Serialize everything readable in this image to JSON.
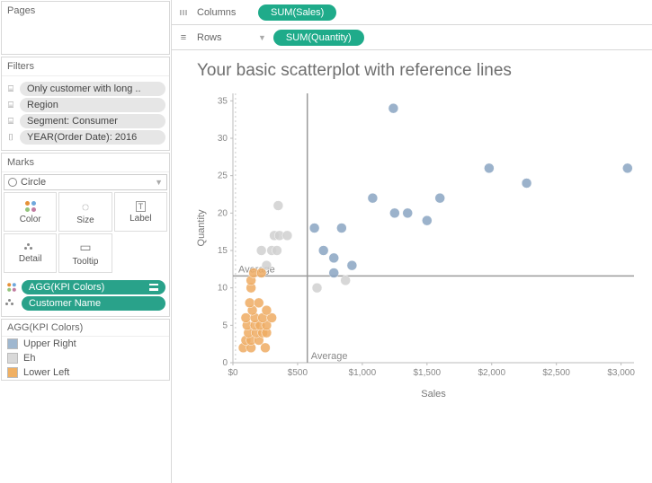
{
  "pages": {
    "label": "Pages"
  },
  "filters": {
    "label": "Filters",
    "items": [
      "Only customer with long ..",
      "Region",
      "Segment: Consumer",
      "YEAR(Order Date): 2016"
    ]
  },
  "marks": {
    "label": "Marks",
    "type": "Circle",
    "cells": [
      "Color",
      "Size",
      "Label",
      "Detail",
      "Tooltip"
    ],
    "pills": [
      "AGG(KPI Colors)",
      "Customer Name"
    ]
  },
  "legend": {
    "title": "AGG(KPI Colors)",
    "items": [
      {
        "label": "Upper Right",
        "color": "#9fb7cf"
      },
      {
        "label": "Eh",
        "color": "#d9d9d9"
      },
      {
        "label": "Lower Left",
        "color": "#f0b063"
      }
    ]
  },
  "shelves": {
    "columns": {
      "label": "Columns",
      "icon": "⦀",
      "pill": "SUM(Sales)"
    },
    "rows": {
      "label": "Rows",
      "icon": "≣",
      "pill": "SUM(Quantity)"
    }
  },
  "chart": {
    "title": "Your basic scatterplot with reference lines",
    "xlabel": "Sales",
    "ylabel": "Quantity",
    "avg_label": "Average"
  },
  "chart_data": {
    "type": "scatter",
    "xlabel": "Sales",
    "ylabel": "Quantity",
    "xlim": [
      0,
      3100
    ],
    "ylim": [
      0,
      36
    ],
    "x_ticks": [
      0,
      500,
      1000,
      1500,
      2000,
      2500,
      3000
    ],
    "x_tick_labels": [
      "$0",
      "$500",
      "$1,000",
      "$1,500",
      "$2,000",
      "$2,500",
      "$3,000"
    ],
    "y_ticks": [
      0,
      5,
      10,
      15,
      20,
      25,
      30,
      35
    ],
    "reference_lines": {
      "x": 575,
      "y": 11.6,
      "label": "Average"
    },
    "series": [
      {
        "name": "Upper Right",
        "color": "#8aa4c2",
        "points": [
          [
            630,
            18
          ],
          [
            840,
            18
          ],
          [
            1240,
            34
          ],
          [
            1080,
            22
          ],
          [
            1250,
            20
          ],
          [
            1350,
            20
          ],
          [
            1600,
            22
          ],
          [
            1500,
            19
          ],
          [
            1980,
            26
          ],
          [
            2270,
            24
          ],
          [
            3050,
            26
          ],
          [
            700,
            15
          ],
          [
            780,
            14
          ],
          [
            780,
            12
          ],
          [
            920,
            13
          ]
        ]
      },
      {
        "name": "Eh",
        "color": "#d0d0d0",
        "points": [
          [
            220,
            15
          ],
          [
            300,
            15
          ],
          [
            340,
            15
          ],
          [
            350,
            21
          ],
          [
            320,
            17
          ],
          [
            360,
            17
          ],
          [
            420,
            17
          ],
          [
            260,
            13
          ],
          [
            650,
            10
          ],
          [
            870,
            11
          ]
        ]
      },
      {
        "name": "Lower Left",
        "color": "#efac63",
        "points": [
          [
            80,
            2
          ],
          [
            140,
            2
          ],
          [
            100,
            3
          ],
          [
            140,
            3
          ],
          [
            200,
            3
          ],
          [
            250,
            2
          ],
          [
            120,
            4
          ],
          [
            180,
            4
          ],
          [
            230,
            4
          ],
          [
            260,
            4
          ],
          [
            110,
            5
          ],
          [
            170,
            5
          ],
          [
            210,
            5
          ],
          [
            260,
            5
          ],
          [
            100,
            6
          ],
          [
            170,
            6
          ],
          [
            230,
            6
          ],
          [
            300,
            6
          ],
          [
            150,
            7
          ],
          [
            260,
            7
          ],
          [
            130,
            8
          ],
          [
            200,
            8
          ],
          [
            140,
            10
          ],
          [
            140,
            11
          ],
          [
            160,
            12
          ],
          [
            220,
            12
          ]
        ]
      }
    ]
  }
}
